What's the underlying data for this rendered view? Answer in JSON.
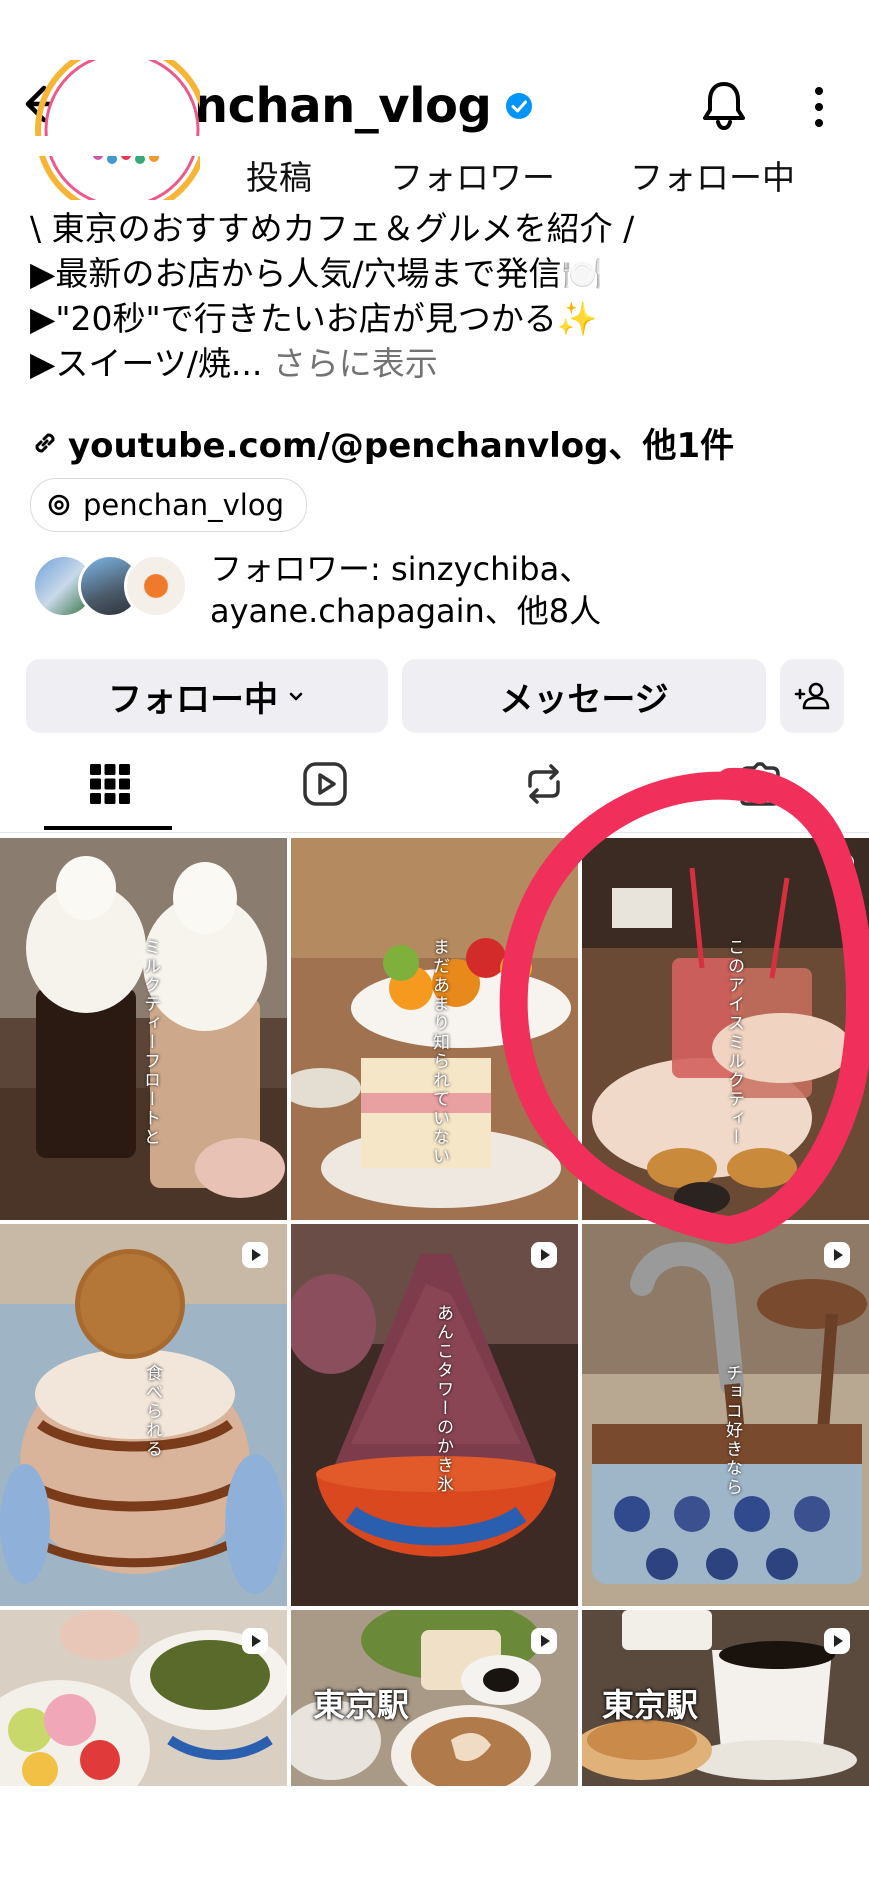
{
  "header": {
    "username": "penchan_vlog",
    "verified": true,
    "back_icon": "arrow-left-icon",
    "bell_icon": "bell-icon",
    "more_icon": "vertical-dots-icon"
  },
  "stats": {
    "posts_label": "投稿",
    "followers_label": "フォロワー",
    "following_label": "フォロー中"
  },
  "bio": {
    "line1": "\\ 東京のおすすめカフェ＆グルメを紹介 /",
    "line2": "▶最新のお店から人気/穴場まで発信🍽️",
    "line3": "▶\"20秒\"で行きたいお店が見つかる✨",
    "line4_prefix": "▶スイーツ/焼...",
    "line4_more": " さらに表示",
    "link_text": "youtube.com/@penchanvlog、他1件",
    "threads_handle": "penchan_vlog"
  },
  "followed_by": {
    "line1": "フォロワー: sinzychiba、",
    "line2": "ayane.chapagain、他8人"
  },
  "actions": {
    "following_label": "フォロー中",
    "message_label": "メッセージ",
    "add_person_icon": "add-person-icon"
  },
  "tabs": [
    {
      "name": "grid",
      "icon": "grid-icon",
      "active": true
    },
    {
      "name": "reels",
      "icon": "reels-icon",
      "active": false
    },
    {
      "name": "reposts",
      "icon": "repost-icon",
      "active": false
    },
    {
      "name": "tagged",
      "icon": "tagged-icon",
      "active": false
    }
  ],
  "grid": {
    "post1_overlay": "ミルクティーフロートと",
    "post2_overlay": "まだあまり知られていない",
    "post3_overlay": "このアイスミルクティー",
    "post4_overlay": "食べられる",
    "post5_overlay": "あんこタワーのかき氷",
    "post6_overlay": "チョコ好きなら",
    "post8_label": "東京駅",
    "post9_label": "東京駅"
  },
  "colors": {
    "accent_blue": "#0095f6",
    "annotation_red": "#f0305a",
    "button_bg": "#efeff3"
  }
}
